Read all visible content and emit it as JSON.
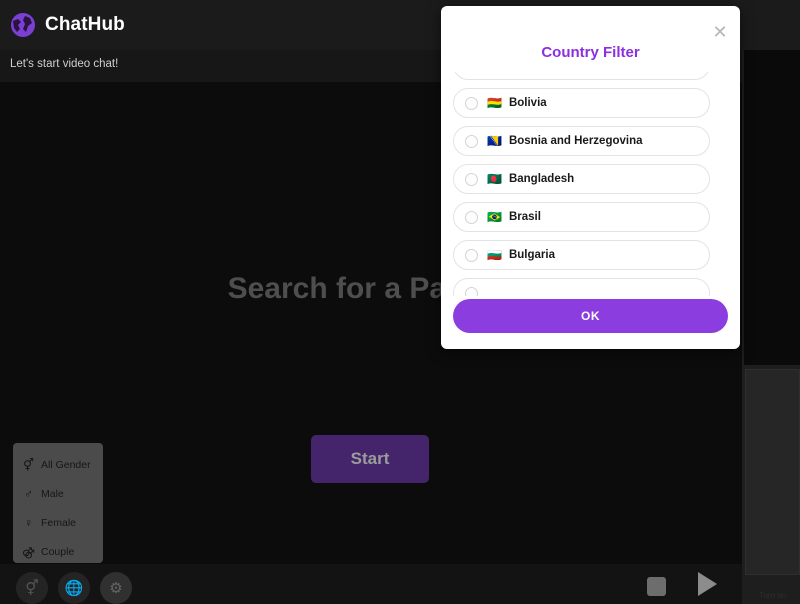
{
  "app": {
    "brand": "ChatHub",
    "logo_icon": "globe-icon"
  },
  "chat": {
    "message": "Let's start video chat!"
  },
  "stage": {
    "title": "Search for a Partner",
    "start_label": "Start"
  },
  "gender_panel": {
    "items": [
      {
        "label": "All Gender",
        "icon": "all-gender-icon",
        "glyph": "⚥"
      },
      {
        "label": "Male",
        "icon": "male-icon",
        "glyph": "♂"
      },
      {
        "label": "Female",
        "icon": "female-icon",
        "glyph": "♀"
      },
      {
        "label": "Couple",
        "icon": "couple-icon",
        "glyph": "⚣"
      }
    ]
  },
  "tools": [
    {
      "name": "gender-filter-tool",
      "glyph": "⚥"
    },
    {
      "name": "country-filter-tool",
      "glyph": "🌐"
    },
    {
      "name": "settings-tool",
      "glyph": "⚙"
    }
  ],
  "media_controls": {
    "stop_name": "stop-button",
    "play_name": "play-button"
  },
  "rail": {
    "caption": "Turn on"
  },
  "modal": {
    "title": "Country Filter",
    "close_glyph": "✕",
    "ok_label": "OK",
    "scrollbar": {
      "up_glyph": "▲",
      "down_glyph": "▼"
    },
    "countries": [
      {
        "name": "",
        "flag": "",
        "selected": false
      },
      {
        "name": "Bolivia",
        "flag": "🇧🇴",
        "selected": false
      },
      {
        "name": "Bosnia and Herzegovina",
        "flag": "🇧🇦",
        "selected": false
      },
      {
        "name": "Bangladesh",
        "flag": "🇧🇩",
        "selected": false
      },
      {
        "name": "Brasil",
        "flag": "🇧🇷",
        "selected": false
      },
      {
        "name": "Bulgaria",
        "flag": "🇧🇬",
        "selected": false
      },
      {
        "name": "",
        "flag": "",
        "selected": false
      }
    ]
  },
  "colors": {
    "accent": "#8c3de0",
    "title_accent": "#8b2fe0",
    "start_bg": "#44256b",
    "app_bg": "#0c0c0c"
  }
}
